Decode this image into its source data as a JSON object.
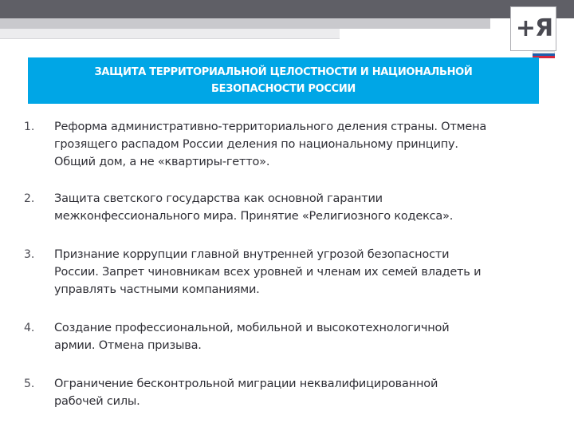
{
  "title": {
    "line1": "ЗАЩИТА ТЕРРИТОРИАЛЬНОЙ ЦЕЛОСТНОСТИ И НАЦИОНАЛЬНОЙ",
    "line2": "БЕЗОПАСНОСТИ РОССИИ"
  },
  "logo": {
    "text": "+Я",
    "icon": "plus-ya-logo",
    "flag_colors": [
      "#ffffff",
      "#1f5fae",
      "#d7263d"
    ]
  },
  "colors": {
    "accent": "#00a6e6",
    "top_bar": "#5f5f66",
    "text": "#2f2f36"
  },
  "items": [
    {
      "number": "1.",
      "lines": [
        "Реформа административно-территориального деления страны. Отмена",
        "грозящего  распадом России деления по национальному принципу.",
        "Общий дом, а не «квартиры-гетто»."
      ]
    },
    {
      "number": "2.",
      "lines": [
        "Защита светского государства как основной гарантии",
        "межконфессионального мира. Принятие «Религиозного кодекса»."
      ]
    },
    {
      "number": "3.",
      "lines": [
        "Признание коррупции главной внутренней угрозой безопасности",
        "России.  Запрет чиновникам всех уровней и членам их семей владеть и",
        "управлять частными компаниями."
      ]
    },
    {
      "number": "4.",
      "lines": [
        "Создание профессиональной, мобильной и высокотехнологичной",
        "армии. Отмена призыва."
      ]
    },
    {
      "number": "5.",
      "lines": [
        "Ограничение бесконтрольной миграции неквалифицированной",
        "рабочей силы."
      ]
    }
  ]
}
